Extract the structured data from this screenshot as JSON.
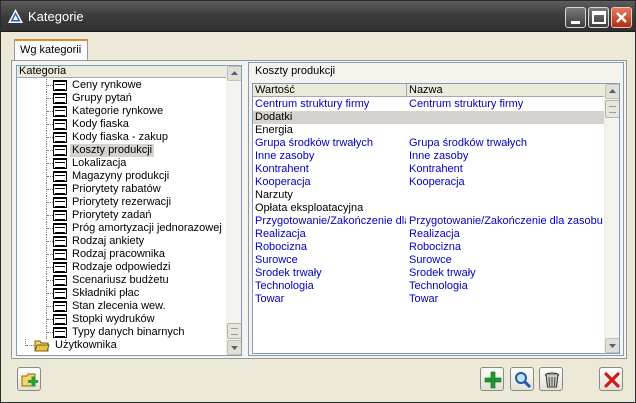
{
  "window": {
    "title": "Kategorie"
  },
  "tabs": [
    {
      "label": "Wg kategorii"
    }
  ],
  "tree": {
    "column_header": "Kategoria",
    "items": [
      "Ceny rynkowe",
      "Grupy pytań",
      "Kategorie rynkowe",
      "Kody fiaska",
      "Kody fiaska - zakup",
      "Koszty produkcji",
      "Lokalizacja",
      "Magazyny produkcji",
      "Priorytety rabatów",
      "Priorytety rezerwacji",
      "Priorytety zadań",
      "Próg amortyzacji jednorazowej",
      "Rodzaj ankiety",
      "Rodzaj pracownika",
      "Rodzaje odpowiedzi",
      "Scenariusz budżetu",
      "Składniki płac",
      "Stan zlecenia wew.",
      "Stopki wydruków",
      "Typy danych binarnych"
    ],
    "selected": "Koszty produkcji",
    "folder_item": "Użytkownika"
  },
  "panel": {
    "title": "Koszty produkcji",
    "columns": [
      "Wartość",
      "Nazwa"
    ],
    "rows": [
      {
        "value": "Centrum struktury firmy",
        "name": "Centrum struktury firmy",
        "blue": true
      },
      {
        "value": "Dodatki",
        "name": "",
        "blue": false,
        "selected": true
      },
      {
        "value": "Energia",
        "name": "",
        "blue": false
      },
      {
        "value": "Grupa środków trwałych",
        "name": "Grupa środków trwałych",
        "blue": true
      },
      {
        "value": "Inne zasoby",
        "name": "Inne zasoby",
        "blue": true
      },
      {
        "value": "Kontrahent",
        "name": "Kontrahent",
        "blue": true
      },
      {
        "value": "Kooperacja",
        "name": "Kooperacja",
        "blue": true
      },
      {
        "value": "Narzuty",
        "name": "",
        "blue": false
      },
      {
        "value": "Opłata eksploatacyjna",
        "name": "",
        "blue": false
      },
      {
        "value": "Przygotowanie/Zakończenie dla zasobu",
        "name": "Przygotowanie/Zakończenie dla zasobu",
        "blue": true
      },
      {
        "value": "Realizacja",
        "name": "Realizacja",
        "blue": true
      },
      {
        "value": "Robocizna",
        "name": "Robocizna",
        "blue": true
      },
      {
        "value": "Surowce",
        "name": "Surowce",
        "blue": true
      },
      {
        "value": "Środek trwały",
        "name": "Środek trwały",
        "blue": true
      },
      {
        "value": "Technologia",
        "name": "Technologia",
        "blue": true
      },
      {
        "value": "Towar",
        "name": "Towar",
        "blue": true
      }
    ]
  },
  "toolbar": {
    "add_folder_icon": "add-folder-icon",
    "add_icon": "plus-icon",
    "search_icon": "magnifier-icon",
    "delete_icon": "trash-icon",
    "close_icon": "red-x-icon"
  },
  "colors": {
    "link_blue": "#0000c8",
    "selection": "#d6d3ce",
    "tab_accent": "#e68b2c"
  }
}
